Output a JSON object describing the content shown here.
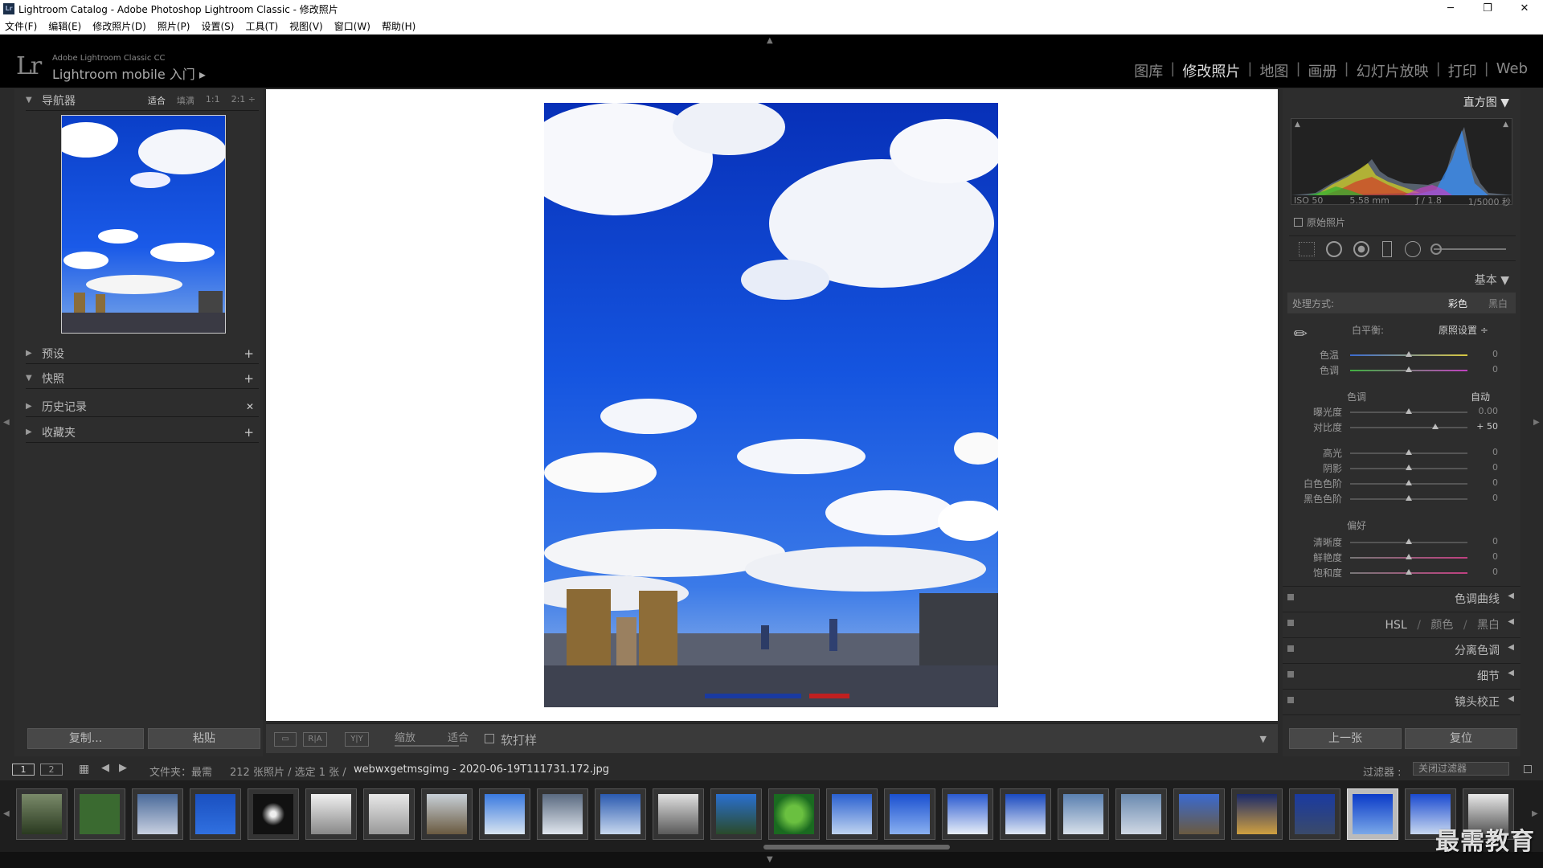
{
  "window": {
    "title": "Lightroom Catalog - Adobe Photoshop Lightroom Classic - 修改照片",
    "icon_text": "Lr",
    "controls": [
      "─",
      "❐",
      "✕"
    ]
  },
  "menu": [
    "文件(F)",
    "编辑(E)",
    "修改照片(D)",
    "照片(P)",
    "设置(S)",
    "工具(T)",
    "视图(V)",
    "窗口(W)",
    "帮助(H)"
  ],
  "identity": {
    "logo": "Lr",
    "product": "Adobe Lightroom Classic CC",
    "mobile": "Lightroom mobile 入门 ▸"
  },
  "modules": [
    "图库",
    "修改照片",
    "地图",
    "画册",
    "幻灯片放映",
    "打印",
    "Web"
  ],
  "active_module": "修改照片",
  "left": {
    "navigator": {
      "title": "导航器",
      "options": [
        "适合",
        "填满",
        "1:1",
        "2:1 ÷"
      ]
    },
    "presets": "预设",
    "snapshots": "快照",
    "history": "历史记录",
    "collections": "收藏夹",
    "copy_button": "复制...",
    "paste_button": "粘贴"
  },
  "toolbar": {
    "zoom_label": "缩放",
    "zoom_value": "适合",
    "softproof": "软打样"
  },
  "right": {
    "histogram_title": "直方图 ▼",
    "exif": [
      "ISO 50",
      "5.58 mm",
      "ƒ / 1.8",
      "1/5000 秒"
    ],
    "original_photo": "原始照片",
    "basic_title": "基本 ▼",
    "treatment_label": "处理方式:",
    "treatment_color": "彩色",
    "treatment_bw": "黑白",
    "wb_label": "白平衡:",
    "wb_value": "原照设置 ÷",
    "temp": {
      "label": "色温",
      "value": "0"
    },
    "tint": {
      "label": "色调",
      "value": "0"
    },
    "tone_label": "色调",
    "auto": "自动",
    "exposure": {
      "label": "曝光度",
      "value": "0.00"
    },
    "contrast": {
      "label": "对比度",
      "value": "+ 50"
    },
    "highlights": {
      "label": "高光",
      "value": "0"
    },
    "shadows": {
      "label": "阴影",
      "value": "0"
    },
    "whites": {
      "label": "白色色阶",
      "value": "0"
    },
    "blacks": {
      "label": "黑色色阶",
      "value": "0"
    },
    "presence_label": "偏好",
    "clarity": {
      "label": "清晰度",
      "value": "0"
    },
    "vibrance": {
      "label": "鲜艳度",
      "value": "0"
    },
    "saturation": {
      "label": "饱和度",
      "value": "0"
    },
    "tone_curve": "色调曲线",
    "hsl": "HSL",
    "hsl_color": "颜色",
    "hsl_bw": "黑白",
    "hsl_sep": "/",
    "split_toning": "分离色调",
    "detail": "细节",
    "lens": "镜头校正",
    "prev_button": "上一张",
    "reset_button": "复位"
  },
  "filmstrip_bar": {
    "page1": "1",
    "page2": "2",
    "source": "文件夹：最需",
    "count": "212 张照片 / 选定 1 张 /",
    "filename": "webwxgetmsgimg - 2020-06-19T111731.172.jpg",
    "filter_label": "过滤器 :",
    "filter_value": "关闭过滤器"
  },
  "watermark": "最需教育"
}
